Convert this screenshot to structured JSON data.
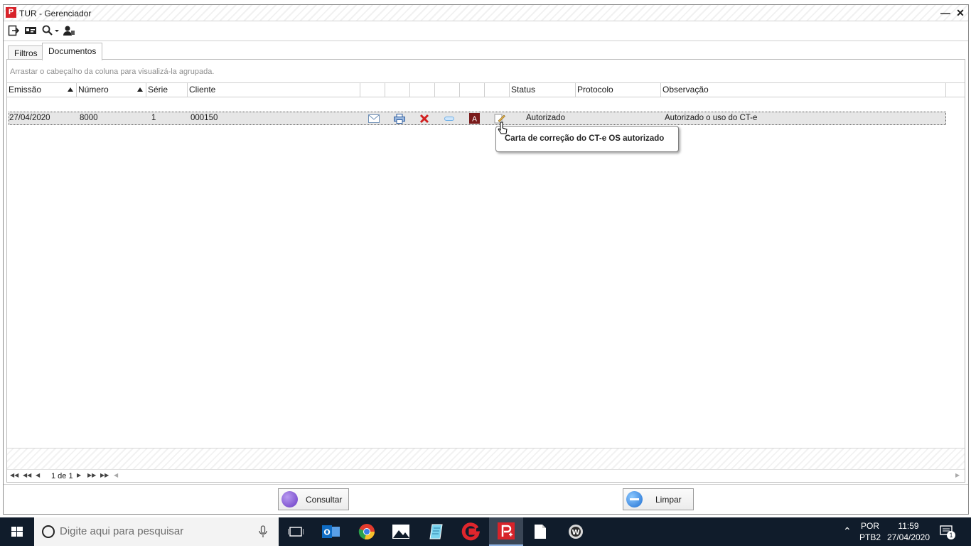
{
  "window": {
    "title": "TUR - Gerenciador",
    "app_icon_letter": "P"
  },
  "toolbar": {
    "buttons": [
      "exit-icon",
      "id-card-icon",
      "search-dropdown-icon",
      "user-icon"
    ]
  },
  "tabs": [
    {
      "label": "Filtros",
      "active": false
    },
    {
      "label": "Documentos",
      "active": true
    }
  ],
  "grid": {
    "group_hint": "Arrastar o cabeçalho da coluna para visualizá-la agrupada.",
    "columns": {
      "emissao": "Emissão",
      "numero": "Número",
      "serie": "Série",
      "cliente": "Cliente",
      "status": "Status",
      "protocolo": "Protocolo",
      "observacao": "Observação"
    },
    "rows": [
      {
        "emissao": "27/04/2020",
        "numero": "8000",
        "serie": "1",
        "cliente": "000150",
        "icons": [
          "email-icon",
          "print-icon",
          "cancel-x-icon",
          "link-icon",
          "pdf-icon",
          "edit-pencil-icon"
        ],
        "status": "Autorizado",
        "protocolo": "",
        "observacao": "Autorizado o uso do CT-e"
      }
    ],
    "tooltip": "Carta de correção do CT-e OS autorizado",
    "pager": {
      "page_text": "1 de 1"
    }
  },
  "footer": {
    "consultar_label": "Consultar",
    "limpar_label": "Limpar"
  },
  "taskbar": {
    "search_placeholder": "Digite aqui para pesquisar",
    "language": "POR",
    "layout": "PTB2",
    "time": "11:59",
    "date": "27/04/2020",
    "notification_count": "1"
  },
  "colors": {
    "brand_red": "#d8232a",
    "taskbar": "#101c2b",
    "row_selected": "#e6e6e6"
  }
}
